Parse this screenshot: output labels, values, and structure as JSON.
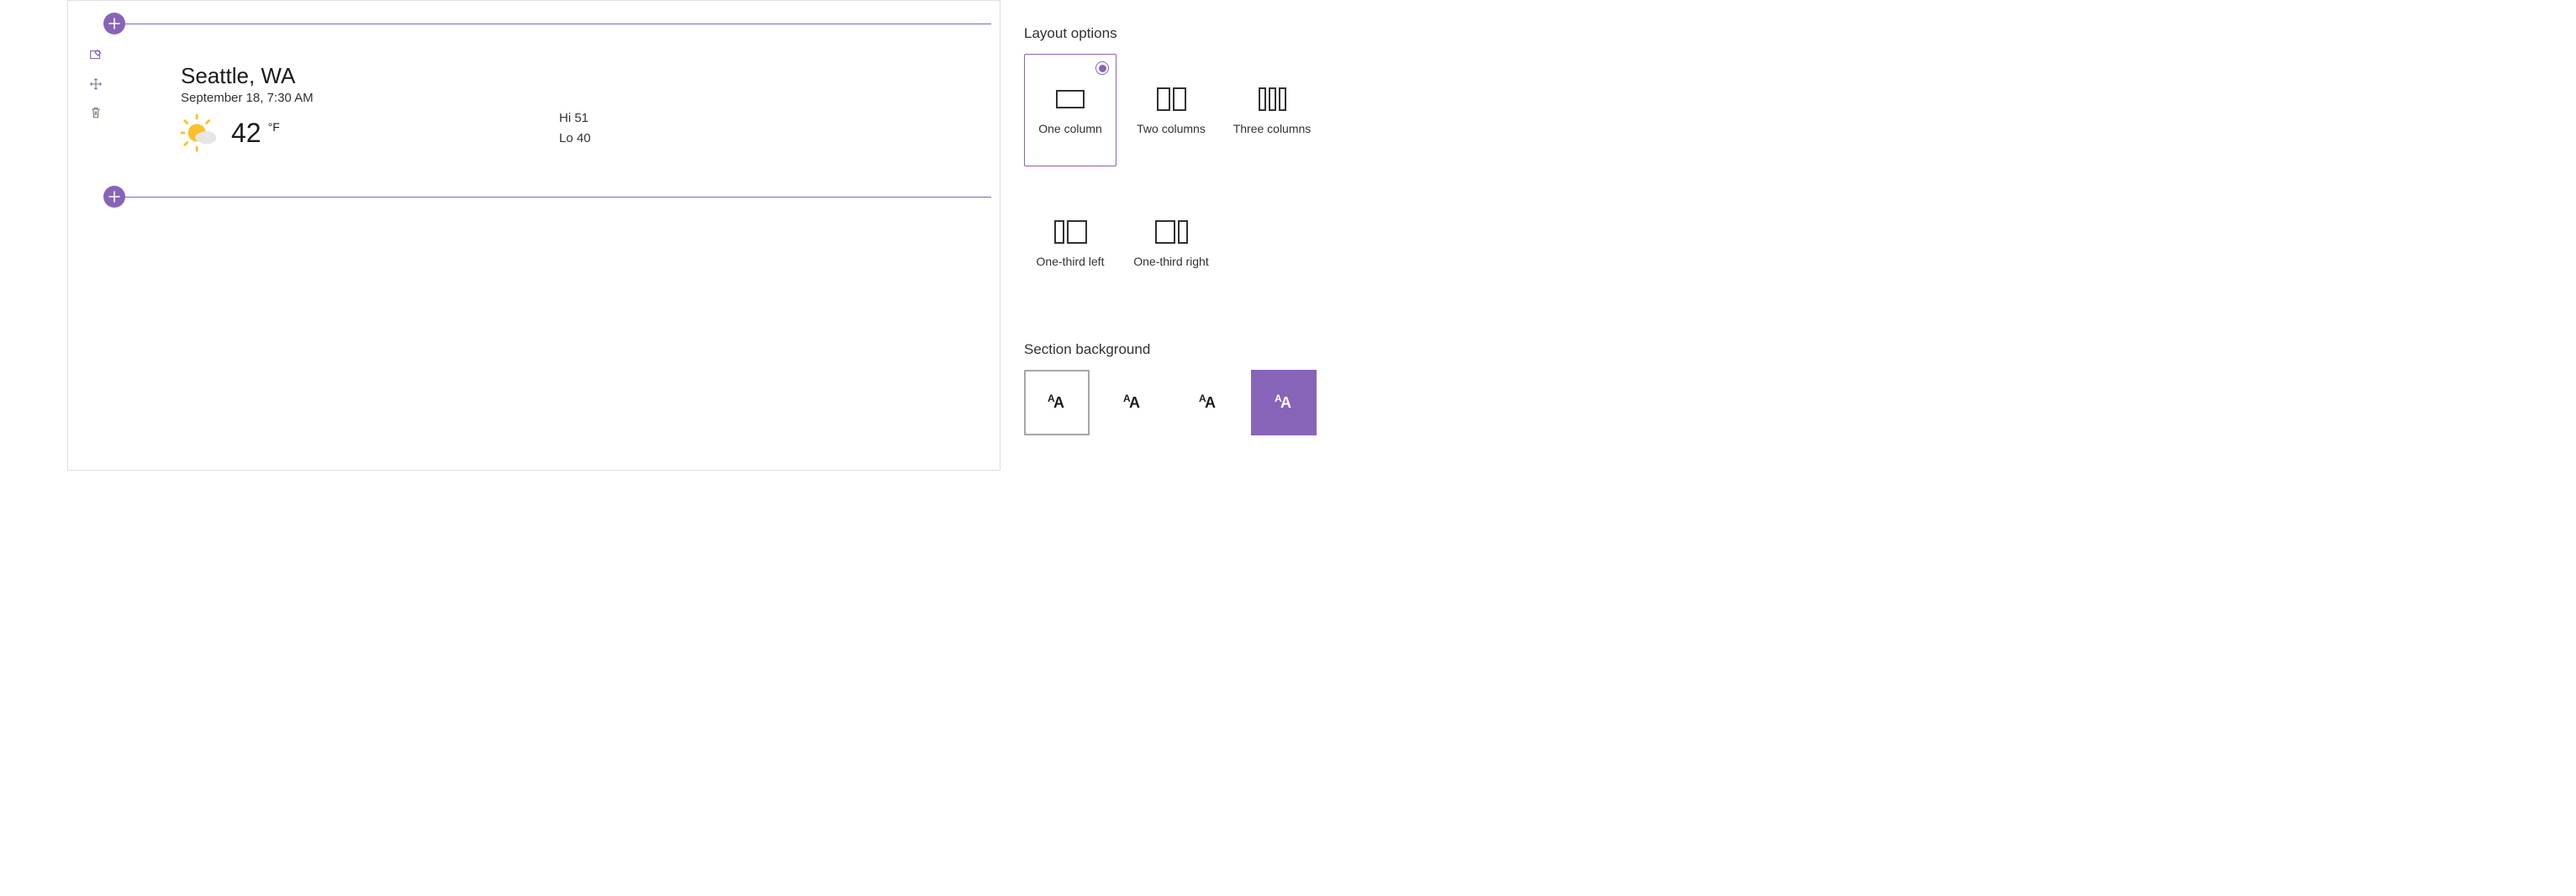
{
  "weather": {
    "location": "Seattle, WA",
    "datetime": "September 18, 7:30 AM",
    "temp": "42",
    "unit": "°F",
    "hi_label": "Hi 51",
    "lo_label": "Lo 40"
  },
  "panel": {
    "layout_heading": "Layout options",
    "background_heading": "Section background",
    "layouts": {
      "one_column": "One column",
      "two_columns": "Two columns",
      "three_columns": "Three columns",
      "one_third_left": "One-third left",
      "one_third_right": "One-third right"
    }
  },
  "colors": {
    "accent": "#8764B8"
  }
}
